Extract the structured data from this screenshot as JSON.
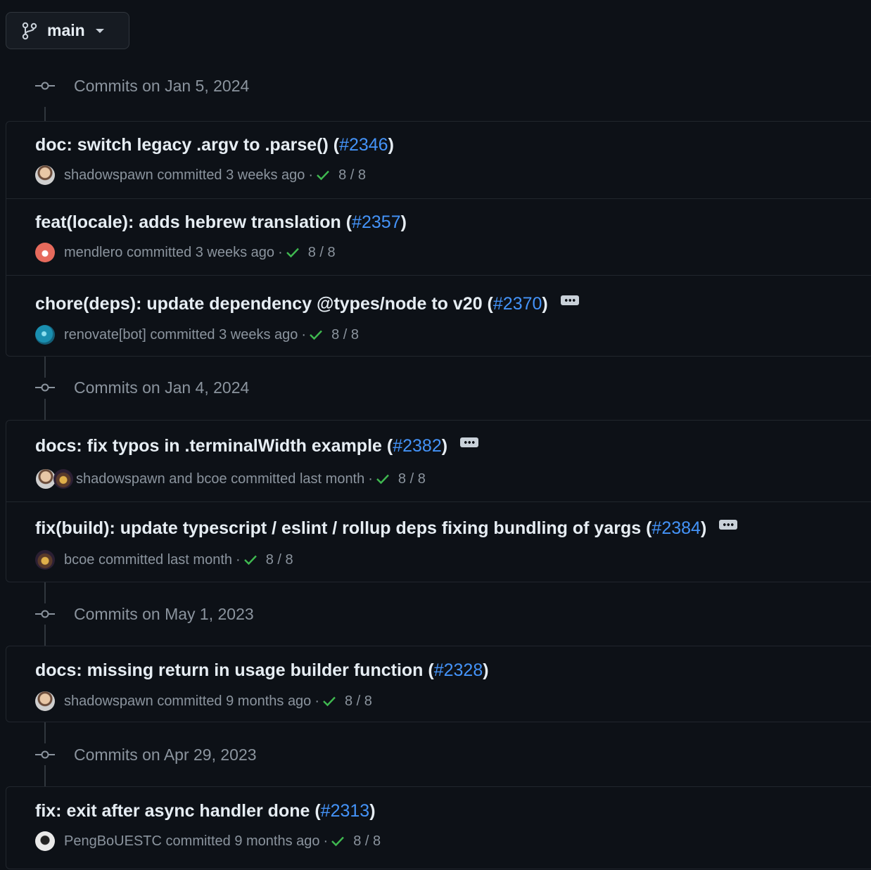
{
  "branch": {
    "name": "main",
    "icon": "git-branch-icon",
    "caret": "chevron-down-icon"
  },
  "colors": {
    "background": "#0d1117",
    "link": "#4493f8",
    "success": "#3fb950",
    "muted": "#8b949e"
  },
  "days": [
    {
      "title": "Commits on Jan 5, 2024",
      "commits": [
        {
          "message": "doc: switch legacy .argv to .parse() (",
          "pr": "#2346",
          "close": ")",
          "has_ellipsis": false,
          "authors": [
            "shadowspawn"
          ],
          "author_text": "shadowspawn",
          "committed": "committed 3 weeks ago",
          "checks": "8 / 8"
        },
        {
          "message": "feat(locale): adds hebrew translation (",
          "pr": "#2357",
          "close": ")",
          "has_ellipsis": false,
          "authors": [
            "mendlero"
          ],
          "author_text": "mendlero",
          "committed": "committed 3 weeks ago",
          "checks": "8 / 8"
        },
        {
          "message": "chore(deps): update dependency @types/node to v20 (",
          "pr": "#2370",
          "close": ")",
          "has_ellipsis": true,
          "authors": [
            "renovate[bot]"
          ],
          "author_text": "renovate[bot]",
          "committed": "committed 3 weeks ago",
          "checks": "8 / 8"
        }
      ]
    },
    {
      "title": "Commits on Jan 4, 2024",
      "commits": [
        {
          "message": "docs: fix typos in .terminalWidth example (",
          "pr": "#2382",
          "close": ")",
          "has_ellipsis": true,
          "authors": [
            "shadowspawn",
            "bcoe"
          ],
          "author_text": "shadowspawn and bcoe",
          "committed": "committed last month",
          "checks": "8 / 8"
        },
        {
          "message": "fix(build): update typescript / eslint / rollup deps fixing bundling of yargs (",
          "pr": "#2384",
          "close": ")",
          "has_ellipsis": true,
          "authors": [
            "bcoe"
          ],
          "author_text": "bcoe",
          "committed": "committed last month",
          "checks": "8 / 8"
        }
      ]
    },
    {
      "title": "Commits on May 1, 2023",
      "commits": [
        {
          "message": "docs: missing return in usage builder function (",
          "pr": "#2328",
          "close": ")",
          "has_ellipsis": false,
          "authors": [
            "shadowspawn"
          ],
          "author_text": "shadowspawn",
          "committed": "committed 9 months ago",
          "checks": "8 / 8"
        }
      ]
    },
    {
      "title": "Commits on Apr 29, 2023",
      "commits": [
        {
          "message": "fix: exit after async handler done (",
          "pr": "#2313",
          "close": ")",
          "has_ellipsis": false,
          "authors": [
            "PengBoUESTC"
          ],
          "author_text": "PengBoUESTC",
          "committed": "committed 9 months ago",
          "checks": "8 / 8"
        }
      ]
    }
  ]
}
